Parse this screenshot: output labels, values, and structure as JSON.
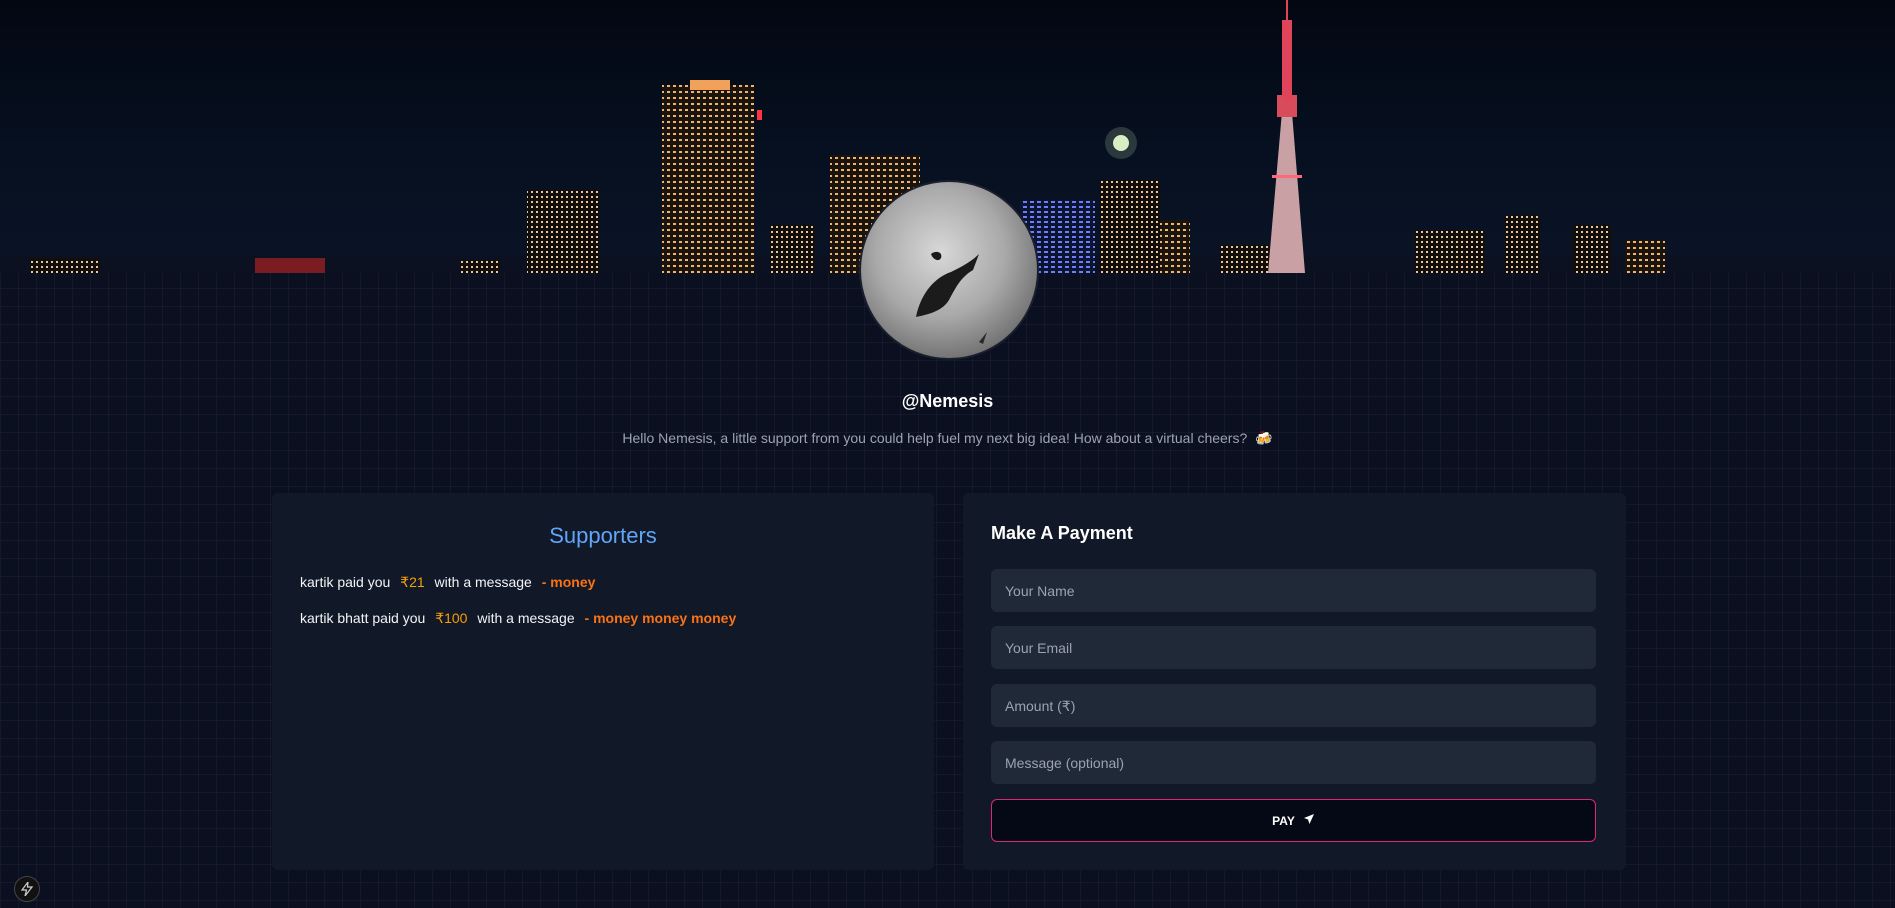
{
  "profile": {
    "username": "@Nemesis",
    "tagline": "Hello Nemesis, a little support from you could help fuel my next big idea! How about a virtual cheers?",
    "tagline_emoji": "🍻"
  },
  "supporters": {
    "title": "Supporters",
    "items": [
      {
        "name": "kartik",
        "paid_text": "paid you",
        "amount": "₹21",
        "with_text": "with a message",
        "message": "- money"
      },
      {
        "name": "kartik bhatt",
        "paid_text": "paid you",
        "amount": "₹100",
        "with_text": "with a message",
        "message": "- money money money"
      }
    ]
  },
  "payment": {
    "title": "Make A Payment",
    "name_placeholder": "Your Name",
    "email_placeholder": "Your Email",
    "amount_placeholder": "Amount (₹)",
    "message_placeholder": "Message (optional)",
    "pay_label": "PAY"
  },
  "colors": {
    "accent_blue": "#60a5fa",
    "amount_yellow": "#f59e0b",
    "message_orange": "#f97316",
    "pay_border": "#db2777",
    "panel_bg": "#111827"
  }
}
